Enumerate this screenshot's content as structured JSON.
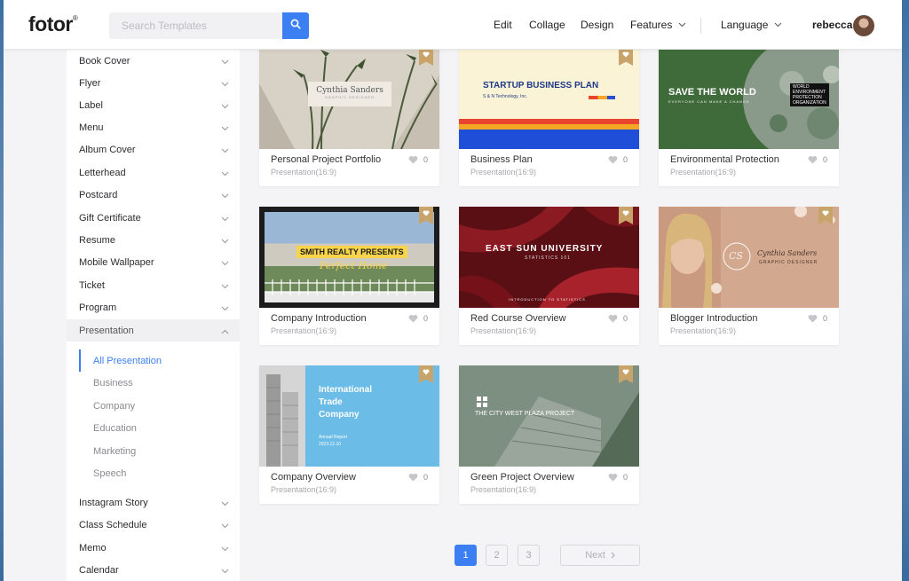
{
  "app": {
    "logo": "fotor",
    "logo_mark": "®"
  },
  "search": {
    "placeholder": "Search Templates"
  },
  "nav": {
    "edit": "Edit",
    "collage": "Collage",
    "design": "Design",
    "features": "Features",
    "language": "Language"
  },
  "user": {
    "name": "rebecca"
  },
  "sidebar": {
    "items": [
      {
        "label": "Book Cover"
      },
      {
        "label": "Flyer"
      },
      {
        "label": "Label"
      },
      {
        "label": "Menu"
      },
      {
        "label": "Album Cover"
      },
      {
        "label": "Letterhead"
      },
      {
        "label": "Postcard"
      },
      {
        "label": "Gift Certificate"
      },
      {
        "label": "Resume"
      },
      {
        "label": "Mobile Wallpaper"
      },
      {
        "label": "Ticket"
      },
      {
        "label": "Program"
      },
      {
        "label": "Presentation"
      }
    ],
    "sub_items": [
      {
        "label": "All Presentation"
      },
      {
        "label": "Business"
      },
      {
        "label": "Company"
      },
      {
        "label": "Education"
      },
      {
        "label": "Marketing"
      },
      {
        "label": "Speech"
      }
    ],
    "items_after": [
      {
        "label": "Instagram Story"
      },
      {
        "label": "Class Schedule"
      },
      {
        "label": "Memo"
      },
      {
        "label": "Calendar"
      }
    ]
  },
  "templates": [
    {
      "title": "Personal Project Portfolio",
      "subtitle": "Presentation(16:9)",
      "likes": "0",
      "thumb": {
        "name": "Cynthia Sanders",
        "role": "GRAPHIC DESIGNER"
      }
    },
    {
      "title": "Business Plan",
      "subtitle": "Presentation(16:9)",
      "likes": "0",
      "thumb": {
        "heading": "STARTUP BUSINESS PLAN",
        "sub": "S & N Technology, Inc."
      }
    },
    {
      "title": "Environmental Protection",
      "subtitle": "Presentation(16:9)",
      "likes": "0",
      "thumb": {
        "heading": "SAVE THE WORLD",
        "sub": "EVERYONE CAN MAKE A CHANGE",
        "tag1": "WORLD",
        "tag2": "ENVIRONMENT",
        "tag3": "PROTECTION",
        "tag4": "ORGANIZATION"
      }
    },
    {
      "title": "Company Introduction",
      "subtitle": "Presentation(16:9)",
      "likes": "0",
      "thumb": {
        "heading": "SMITH REALTY PRESENTS",
        "sub": "Perfect Home"
      }
    },
    {
      "title": "Red Course Overview",
      "subtitle": "Presentation(16:9)",
      "likes": "0",
      "thumb": {
        "heading": "EAST SUN UNIVERSITY",
        "sub": "STATISTICS 101",
        "foot": "INTRODUCTION TO STATISTICS"
      }
    },
    {
      "title": "Blogger Introduction",
      "subtitle": "Presentation(16:9)",
      "likes": "0",
      "thumb": {
        "mono": "CS",
        "name": "Cynthia Sanders",
        "role": "GRAPHIC DESIGNER"
      }
    },
    {
      "title": "Company Overview",
      "subtitle": "Presentation(16:9)",
      "likes": "0",
      "thumb": {
        "line1": "International",
        "line2": "Trade",
        "line3": "Company",
        "sub": "Annual Report",
        "date": "2023.12.10"
      }
    },
    {
      "title": "Green Project Overview",
      "subtitle": "Presentation(16:9)",
      "likes": "0",
      "thumb": {
        "heading": "THE CITY WEST PLAZA PROJECT"
      }
    }
  ],
  "pagination": {
    "pages": [
      "1",
      "2",
      "3"
    ],
    "current": "1",
    "next": "Next"
  },
  "colors": {
    "accent": "#3c7ff2",
    "badge": "#c9a46a"
  }
}
